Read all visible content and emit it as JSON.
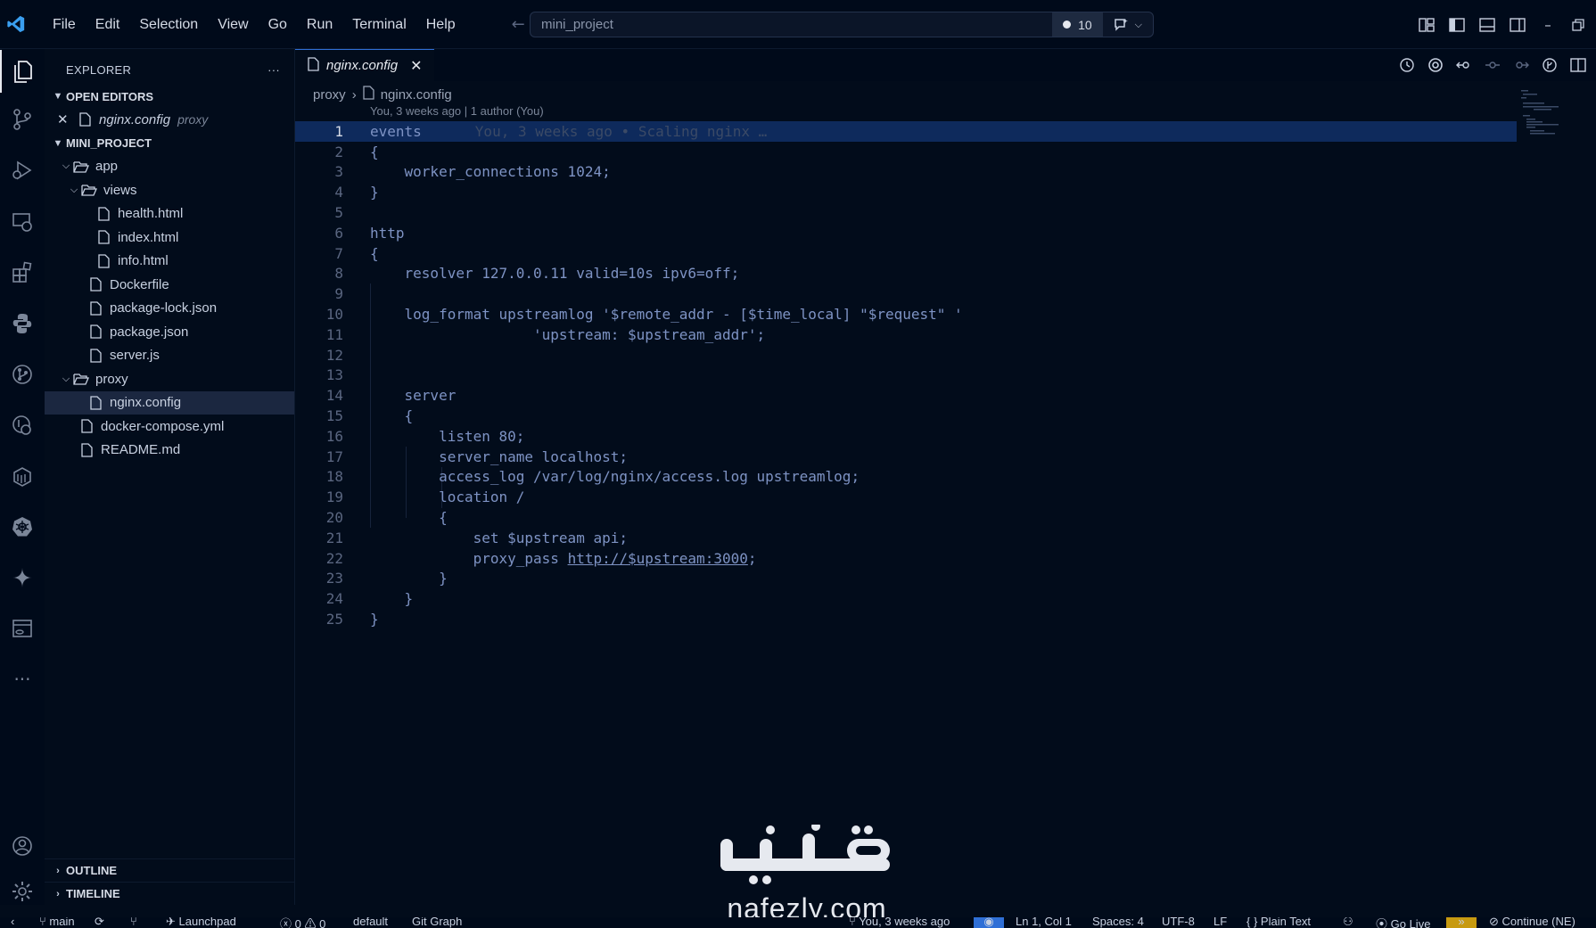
{
  "titlebar": {
    "menu": [
      "File",
      "Edit",
      "Selection",
      "View",
      "Go",
      "Run",
      "Terminal",
      "Help"
    ],
    "search_text": "mini_project",
    "badge_count": "10"
  },
  "explorer": {
    "title": "EXPLORER",
    "more": "···",
    "open_editors_label": "OPEN EDITORS",
    "open_editor_file": "nginx.config",
    "open_editor_folder": "proxy",
    "project_label": "MINI_PROJECT",
    "tree": {
      "app": "app",
      "views": "views",
      "health": "health.html",
      "index": "index.html",
      "info": "info.html",
      "dockerfile": "Dockerfile",
      "package_lock": "package-lock.json",
      "package_json": "package.json",
      "server": "server.js",
      "proxy": "proxy",
      "nginx": "nginx.config",
      "compose": "docker-compose.yml",
      "readme": "README.md"
    },
    "outline_label": "OUTLINE",
    "timeline_label": "TIMELINE"
  },
  "editor": {
    "tab_label": "nginx.config",
    "breadcrumb_folder": "proxy",
    "breadcrumb_file": "nginx.config",
    "blame_header": "You, 3 weeks ago | 1 author (You)",
    "blame_inline": "You, 3 weeks ago • Scaling nginx …",
    "lines": [
      "events",
      "{",
      "    worker_connections 1024;",
      "}",
      "",
      "http",
      "{",
      "    resolver 127.0.0.11 valid=10s ipv6=off;",
      "",
      "    log_format upstreamlog '$remote_addr - [$time_local] \"$request\" '",
      "                   'upstream: $upstream_addr';",
      "",
      "",
      "    server",
      "    {",
      "        listen 80;",
      "        server_name localhost;",
      "        access_log /var/log/nginx/access.log upstreamlog;",
      "        location /",
      "        {",
      "            set $upstream api;",
      "            proxy_pass ",
      "        }",
      "    }",
      "}"
    ],
    "proxy_url": "http://$upstream:3000",
    "proxy_tail": ";"
  },
  "watermark": {
    "url": "nafezly.com"
  },
  "statusbar": {
    "branch": "main",
    "launchpad": "Launchpad",
    "problems": "0",
    "warnings": "0",
    "profile": "default",
    "git_graph": "Git Graph",
    "blame": "You, 3 weeks ago",
    "position": "Ln 1, Col 1",
    "spaces": "Spaces: 4",
    "encoding": "UTF-8",
    "eol": "LF",
    "language": "Plain Text",
    "golive": "Go Live",
    "continue": "Continue (NE)"
  }
}
